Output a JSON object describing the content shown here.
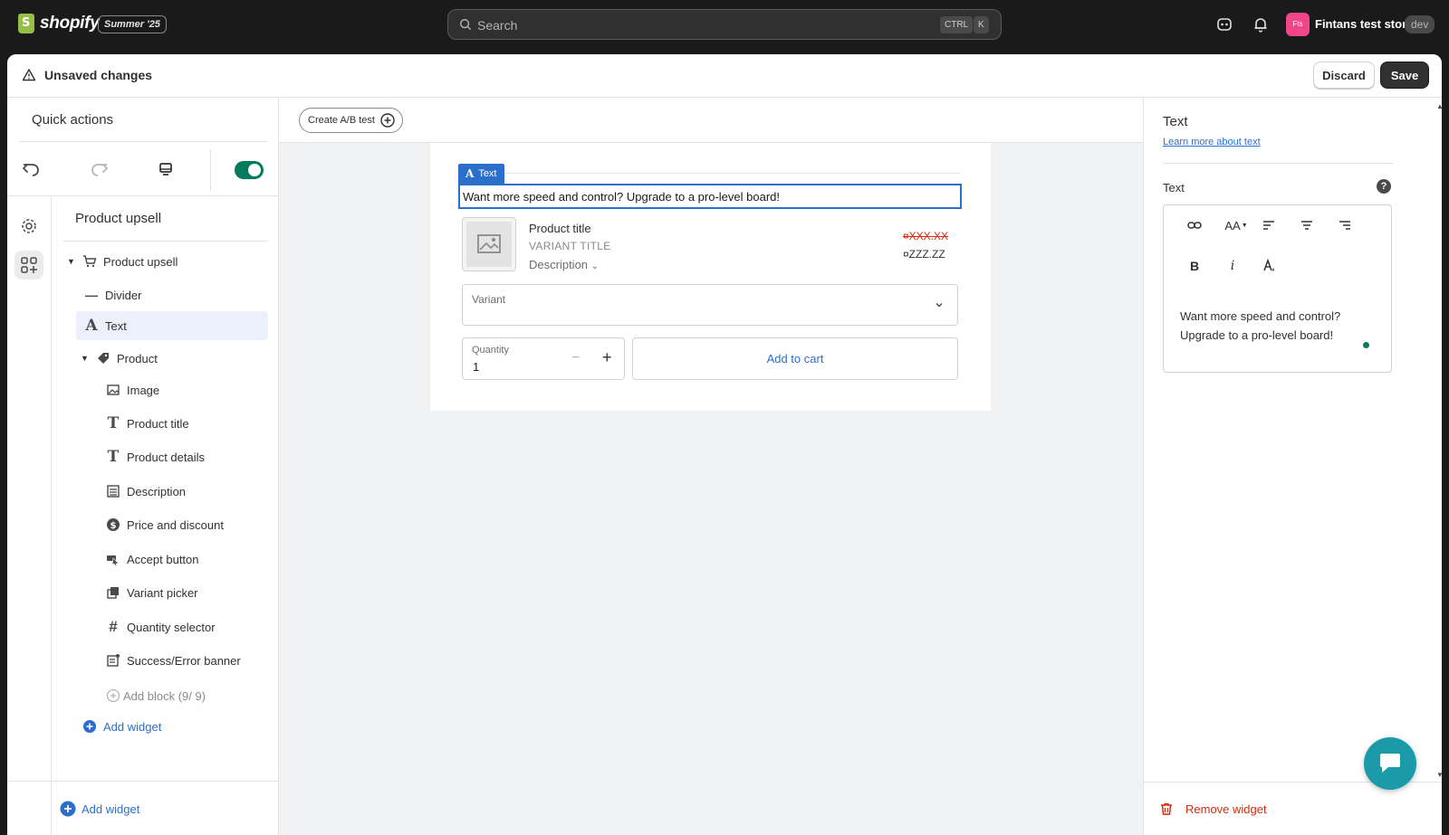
{
  "topbar": {
    "logo_text": "shopify",
    "edition": "Summer '25",
    "search_placeholder": "Search",
    "shortcut_ctrl": "CTRL",
    "shortcut_k": "K",
    "store_avatar": "Fts",
    "store_name": "Fintans test store",
    "store_badge": "dev",
    "icons": [
      "logo-bag-icon",
      "search-icon",
      "sidekick-icon",
      "bell-icon"
    ]
  },
  "savebar": {
    "message": "Unsaved changes",
    "discard_label": "Discard",
    "save_label": "Save"
  },
  "left": {
    "quick_actions_title": "Quick actions",
    "toggle_on": true,
    "panel_title": "Product upsell",
    "tree": {
      "root": "Product upsell",
      "divider": "Divider",
      "text": "Text",
      "product": "Product",
      "image": "Image",
      "product_title": "Product title",
      "product_details": "Product details",
      "description": "Description",
      "price_discount": "Price and discount",
      "accept_button": "Accept button",
      "variant_picker": "Variant picker",
      "quantity_selector": "Quantity selector",
      "banner": "Success/Error banner",
      "add_block": "Add block (9/ 9)",
      "add_widget": "Add widget"
    },
    "bottom_add_widget": "Add widget"
  },
  "canvas": {
    "ab_test_label": "Create A/B test",
    "text_tag": "Text",
    "text_value": "Want more speed and control? Upgrade to a pro-level board!",
    "product_title": "Product title",
    "variant_title": "VARIANT TITLE",
    "description_label": "Description",
    "old_price": "¤XXX.XX",
    "new_price": "¤ZZZ.ZZ",
    "variant_label": "Variant",
    "quantity_label": "Quantity",
    "quantity_value": "1",
    "minus": "−",
    "plus": "+",
    "add_to_cart": "Add to cart"
  },
  "right": {
    "title": "Text",
    "learn_link": "Learn more about text",
    "field_label": "Text",
    "help": "?",
    "toolbar": {
      "bold": "B",
      "italic": "i",
      "font_size": "AA"
    },
    "editor_line1": "Want more speed and control?",
    "editor_line2": "Upgrade to a pro-level board!",
    "remove_widget": "Remove widget"
  },
  "colors": {
    "accent": "#2c6ecb",
    "success": "#047b5d",
    "critical": "#d72c0d",
    "topbar": "#1a1a1a",
    "chat": "#1b9aaa"
  }
}
